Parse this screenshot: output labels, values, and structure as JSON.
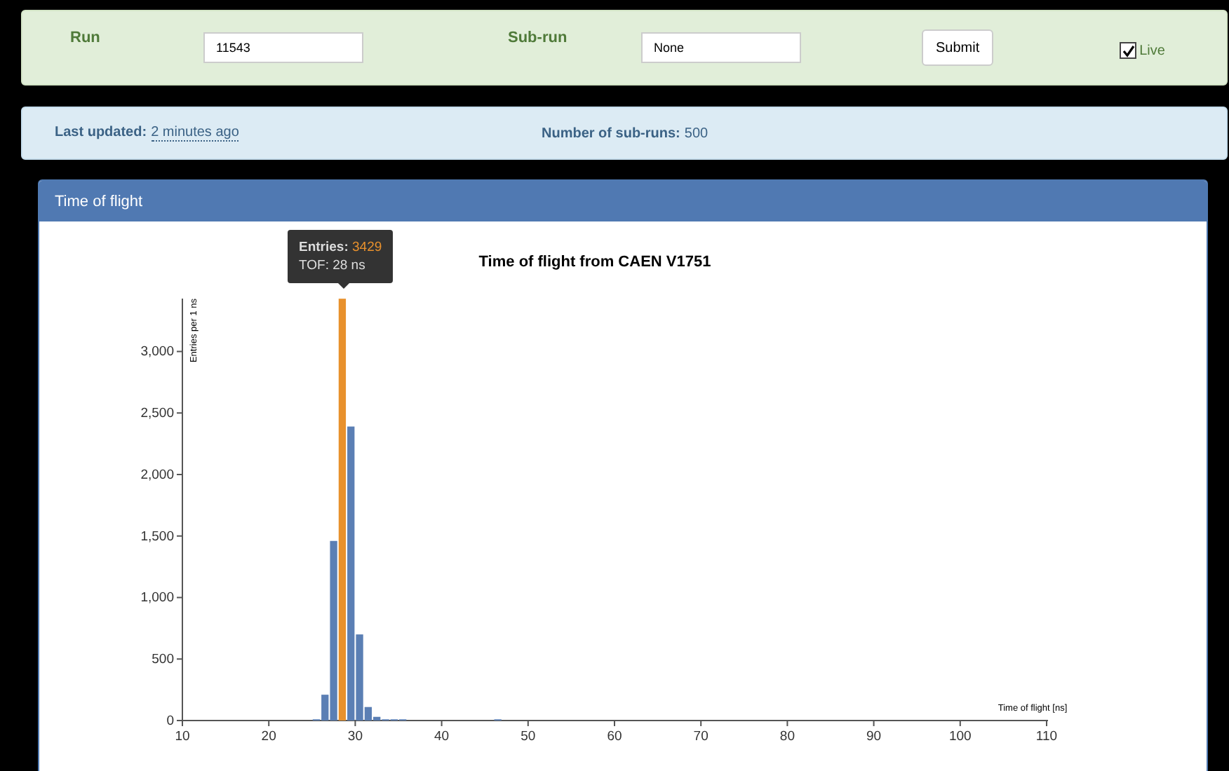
{
  "form": {
    "run_label": "Run",
    "run_value": "11543",
    "subrun_label": "Sub-run",
    "subrun_value": "None",
    "submit": "Submit",
    "live": {
      "label": "Live",
      "checked": true
    }
  },
  "info": {
    "updated_label": "Last updated:",
    "updated_value": "2 minutes ago",
    "subruns_label": "Number of sub-runs:",
    "subruns_value": "500"
  },
  "panel": {
    "title": "Time of flight",
    "tooltip": {
      "label": "Entries:",
      "value": "3429",
      "detail": "TOF: 28 ns"
    },
    "chart_data": {
      "type": "bar",
      "title": "Time of flight from CAEN V1751",
      "xlabel": "Time of flight [ns]",
      "ylabel": "Entries per 1 ns",
      "x": [
        25,
        26,
        27,
        28,
        29,
        30,
        31,
        32,
        33,
        34,
        35,
        46
      ],
      "series": [
        {
          "color": "#5b7fb4",
          "values": [
            10,
            210,
            1460,
            null,
            2390,
            700,
            110,
            30,
            10,
            10,
            10,
            10
          ]
        },
        {
          "color": "#e8912d",
          "values": [
            null,
            null,
            null,
            3429,
            null,
            null,
            null,
            null,
            null,
            null,
            null,
            null
          ]
        }
      ],
      "xlim": [
        10,
        110
      ],
      "ylim": [
        0,
        3430
      ],
      "xticks": [
        10,
        20,
        30,
        40,
        50,
        60,
        70,
        80,
        90,
        100,
        110
      ],
      "yticks": [
        {
          "value": 0,
          "label": "0"
        },
        {
          "value": 500,
          "label": "500"
        },
        {
          "value": 1000,
          "label": "1,000"
        },
        {
          "value": 1500,
          "label": "1,500"
        },
        {
          "value": 2000,
          "label": "2,000"
        },
        {
          "value": 2500,
          "label": "2,500"
        },
        {
          "value": 3000,
          "label": "3,000"
        }
      ]
    }
  }
}
